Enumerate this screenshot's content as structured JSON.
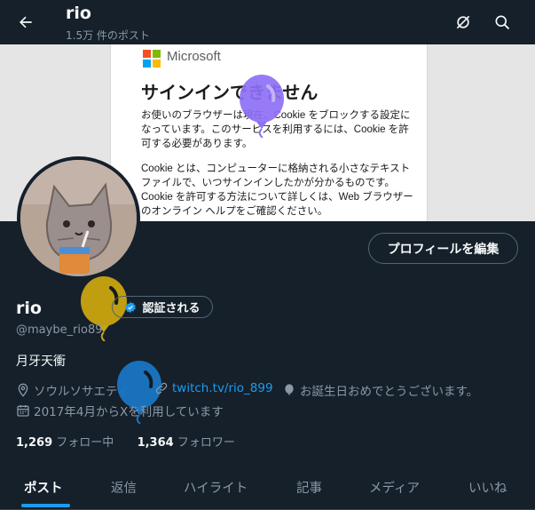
{
  "topbar": {
    "title": "rio",
    "post_count": "1.5万 件のポスト"
  },
  "banner": {
    "brand": "Microsoft",
    "heading": "サインインできません",
    "para1": "お使いのブラウザーは現在、Cookie をブロックする設定になっています。このサービスを利用するには、Cookie を許可する必要があります。",
    "para2": "Cookie とは、コンピューターに格納される小さなテキスト ファイルで、いつサインインしたかが分かるものです。Cookie を許可する方法について詳しくは、Web ブラウザーのオンライン ヘルプをご確認ください。"
  },
  "profile": {
    "edit_label": "プロフィールを編集",
    "name": "rio",
    "verify_label": "認証される",
    "handle": "@maybe_rio89",
    "bio": "月牙天衝",
    "location": "ソウルソサエティ",
    "link": "twitch.tv/rio_899",
    "birthday": "お誕生日おめでとうございます。",
    "joined": "2017年4月からXを利用しています",
    "following_count": "1,269",
    "following_label": "フォロー中",
    "followers_count": "1,364",
    "followers_label": "フォロワー"
  },
  "tabs": [
    {
      "label": "ポスト",
      "active": true
    },
    {
      "label": "返信"
    },
    {
      "label": "ハイライト"
    },
    {
      "label": "記事"
    },
    {
      "label": "メディア"
    },
    {
      "label": "いいね"
    }
  ],
  "colors": {
    "background": "#15202b",
    "accent": "#1d9bf0",
    "muted": "#8b98a5"
  },
  "icons": [
    "back-arrow-icon",
    "no-search-icon",
    "search-icon",
    "verified-badge-icon",
    "location-icon",
    "link-icon",
    "balloon-icon",
    "calendar-icon"
  ]
}
